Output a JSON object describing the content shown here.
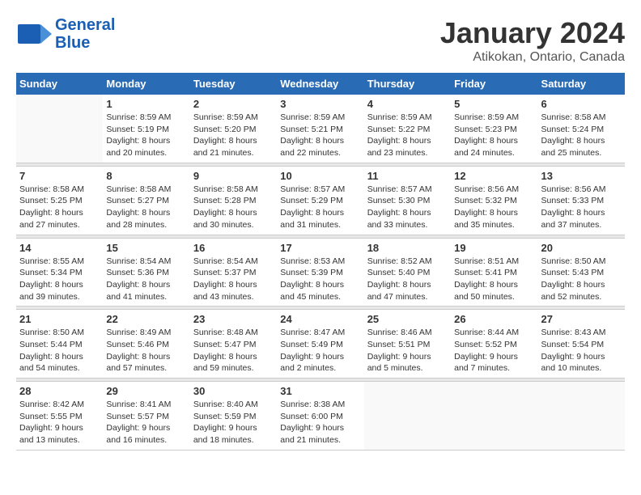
{
  "header": {
    "logo_line1": "General",
    "logo_line2": "Blue",
    "month": "January 2024",
    "location": "Atikokan, Ontario, Canada"
  },
  "columns": [
    "Sunday",
    "Monday",
    "Tuesday",
    "Wednesday",
    "Thursday",
    "Friday",
    "Saturday"
  ],
  "weeks": [
    [
      {
        "day": "",
        "info": ""
      },
      {
        "day": "1",
        "info": "Sunrise: 8:59 AM\nSunset: 5:19 PM\nDaylight: 8 hours\nand 20 minutes."
      },
      {
        "day": "2",
        "info": "Sunrise: 8:59 AM\nSunset: 5:20 PM\nDaylight: 8 hours\nand 21 minutes."
      },
      {
        "day": "3",
        "info": "Sunrise: 8:59 AM\nSunset: 5:21 PM\nDaylight: 8 hours\nand 22 minutes."
      },
      {
        "day": "4",
        "info": "Sunrise: 8:59 AM\nSunset: 5:22 PM\nDaylight: 8 hours\nand 23 minutes."
      },
      {
        "day": "5",
        "info": "Sunrise: 8:59 AM\nSunset: 5:23 PM\nDaylight: 8 hours\nand 24 minutes."
      },
      {
        "day": "6",
        "info": "Sunrise: 8:58 AM\nSunset: 5:24 PM\nDaylight: 8 hours\nand 25 minutes."
      }
    ],
    [
      {
        "day": "7",
        "info": "Sunrise: 8:58 AM\nSunset: 5:25 PM\nDaylight: 8 hours\nand 27 minutes."
      },
      {
        "day": "8",
        "info": "Sunrise: 8:58 AM\nSunset: 5:27 PM\nDaylight: 8 hours\nand 28 minutes."
      },
      {
        "day": "9",
        "info": "Sunrise: 8:58 AM\nSunset: 5:28 PM\nDaylight: 8 hours\nand 30 minutes."
      },
      {
        "day": "10",
        "info": "Sunrise: 8:57 AM\nSunset: 5:29 PM\nDaylight: 8 hours\nand 31 minutes."
      },
      {
        "day": "11",
        "info": "Sunrise: 8:57 AM\nSunset: 5:30 PM\nDaylight: 8 hours\nand 33 minutes."
      },
      {
        "day": "12",
        "info": "Sunrise: 8:56 AM\nSunset: 5:32 PM\nDaylight: 8 hours\nand 35 minutes."
      },
      {
        "day": "13",
        "info": "Sunrise: 8:56 AM\nSunset: 5:33 PM\nDaylight: 8 hours\nand 37 minutes."
      }
    ],
    [
      {
        "day": "14",
        "info": "Sunrise: 8:55 AM\nSunset: 5:34 PM\nDaylight: 8 hours\nand 39 minutes."
      },
      {
        "day": "15",
        "info": "Sunrise: 8:54 AM\nSunset: 5:36 PM\nDaylight: 8 hours\nand 41 minutes."
      },
      {
        "day": "16",
        "info": "Sunrise: 8:54 AM\nSunset: 5:37 PM\nDaylight: 8 hours\nand 43 minutes."
      },
      {
        "day": "17",
        "info": "Sunrise: 8:53 AM\nSunset: 5:39 PM\nDaylight: 8 hours\nand 45 minutes."
      },
      {
        "day": "18",
        "info": "Sunrise: 8:52 AM\nSunset: 5:40 PM\nDaylight: 8 hours\nand 47 minutes."
      },
      {
        "day": "19",
        "info": "Sunrise: 8:51 AM\nSunset: 5:41 PM\nDaylight: 8 hours\nand 50 minutes."
      },
      {
        "day": "20",
        "info": "Sunrise: 8:50 AM\nSunset: 5:43 PM\nDaylight: 8 hours\nand 52 minutes."
      }
    ],
    [
      {
        "day": "21",
        "info": "Sunrise: 8:50 AM\nSunset: 5:44 PM\nDaylight: 8 hours\nand 54 minutes."
      },
      {
        "day": "22",
        "info": "Sunrise: 8:49 AM\nSunset: 5:46 PM\nDaylight: 8 hours\nand 57 minutes."
      },
      {
        "day": "23",
        "info": "Sunrise: 8:48 AM\nSunset: 5:47 PM\nDaylight: 8 hours\nand 59 minutes."
      },
      {
        "day": "24",
        "info": "Sunrise: 8:47 AM\nSunset: 5:49 PM\nDaylight: 9 hours\nand 2 minutes."
      },
      {
        "day": "25",
        "info": "Sunrise: 8:46 AM\nSunset: 5:51 PM\nDaylight: 9 hours\nand 5 minutes."
      },
      {
        "day": "26",
        "info": "Sunrise: 8:44 AM\nSunset: 5:52 PM\nDaylight: 9 hours\nand 7 minutes."
      },
      {
        "day": "27",
        "info": "Sunrise: 8:43 AM\nSunset: 5:54 PM\nDaylight: 9 hours\nand 10 minutes."
      }
    ],
    [
      {
        "day": "28",
        "info": "Sunrise: 8:42 AM\nSunset: 5:55 PM\nDaylight: 9 hours\nand 13 minutes."
      },
      {
        "day": "29",
        "info": "Sunrise: 8:41 AM\nSunset: 5:57 PM\nDaylight: 9 hours\nand 16 minutes."
      },
      {
        "day": "30",
        "info": "Sunrise: 8:40 AM\nSunset: 5:59 PM\nDaylight: 9 hours\nand 18 minutes."
      },
      {
        "day": "31",
        "info": "Sunrise: 8:38 AM\nSunset: 6:00 PM\nDaylight: 9 hours\nand 21 minutes."
      },
      {
        "day": "",
        "info": ""
      },
      {
        "day": "",
        "info": ""
      },
      {
        "day": "",
        "info": ""
      }
    ]
  ]
}
